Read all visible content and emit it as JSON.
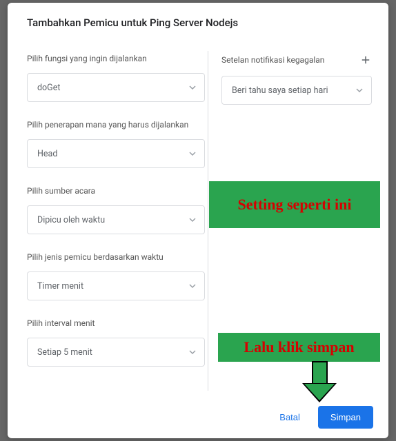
{
  "title": "Tambahkan Pemicu untuk Ping Server Nodejs",
  "left": {
    "f1_label": "Pilih fungsi yang ingin dijalankan",
    "f1_value": "doGet",
    "f2_label": "Pilih penerapan mana yang harus dijalankan",
    "f2_value": "Head",
    "f3_label": "Pilih sumber acara",
    "f3_value": "Dipicu oleh waktu",
    "f4_label": "Pilih jenis pemicu berdasarkan waktu",
    "f4_value": "Timer menit",
    "f5_label": "Pilih interval menit",
    "f5_value": "Setiap 5 menit"
  },
  "right": {
    "notif_label": "Setelan notifikasi kegagalan",
    "notif_value": "Beri tahu saya setiap hari"
  },
  "footer": {
    "cancel": "Batal",
    "save": "Simpan"
  },
  "annotation": {
    "a1": "Setting seperti ini",
    "a2": "Lalu klik simpan"
  }
}
